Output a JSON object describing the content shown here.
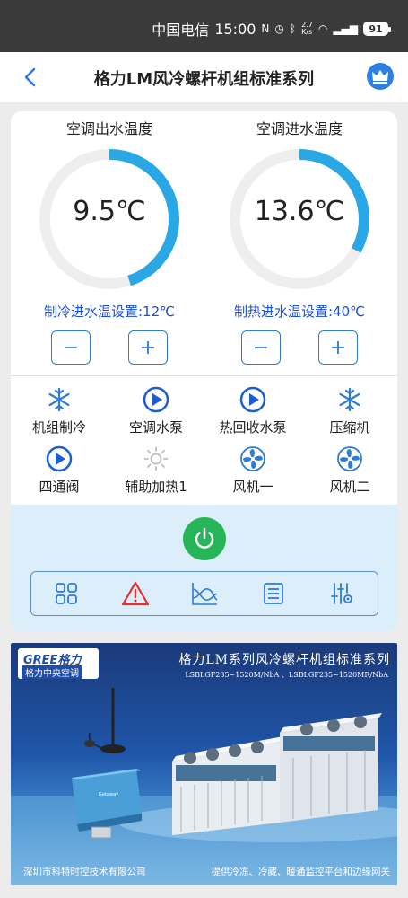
{
  "status_bar": {
    "carrier": "中国电信",
    "time": "15:00",
    "speed_value": "2.7",
    "speed_unit": "K/s",
    "battery": "91"
  },
  "header": {
    "title": "格力LM风冷螺杆机组标准系列",
    "back_icon": "chevron-left-icon",
    "crown_icon": "crown-icon"
  },
  "gauges": [
    {
      "label": "空调出水温度",
      "value": "9.5℃",
      "fill": 0.45
    },
    {
      "label": "空调进水温度",
      "value": "13.6℃",
      "fill": 0.33
    }
  ],
  "setpoints": {
    "cooling": "制冷进水温设置:12℃",
    "heating": "制热进水温设置:40℃",
    "minus": "−",
    "plus": "+"
  },
  "status_items": [
    {
      "label": "机组制冷",
      "icon": "snowflake-icon"
    },
    {
      "label": "空调水泵",
      "icon": "play-icon"
    },
    {
      "label": "热回收水泵",
      "icon": "play-icon"
    },
    {
      "label": "压缩机",
      "icon": "snowflake-icon"
    },
    {
      "label": "四通阀",
      "icon": "play-icon"
    },
    {
      "label": "辅助加热1",
      "icon": "sun-icon"
    },
    {
      "label": "风机一",
      "icon": "fan-icon"
    },
    {
      "label": "风机二",
      "icon": "fan-icon"
    }
  ],
  "toolbar": [
    "grid-icon",
    "alarm-icon",
    "chart-icon",
    "list-icon",
    "settings-sliders-icon"
  ],
  "banner": {
    "logo_text": "GREE格力",
    "logo_sub": "格力中央空调",
    "title": "格力LM系列风冷螺杆机组标准系列",
    "model": "LSBLGF235~1520M/NbA 、LSBLGF235~1520MR/NbA",
    "footer_left": "深圳市科特时控技术有限公司",
    "footer_right": "提供冷冻、冷藏、暖通监控平台和边缘网关"
  },
  "colors": {
    "accent": "#2e7bd6",
    "gauge_track": "#eeeeee",
    "gauge_fill": "#2aa8e6",
    "setpoint_text": "#1a4fd6",
    "power": "#27b55a",
    "alarm": "#e23030",
    "panel": "#dbeef9"
  }
}
